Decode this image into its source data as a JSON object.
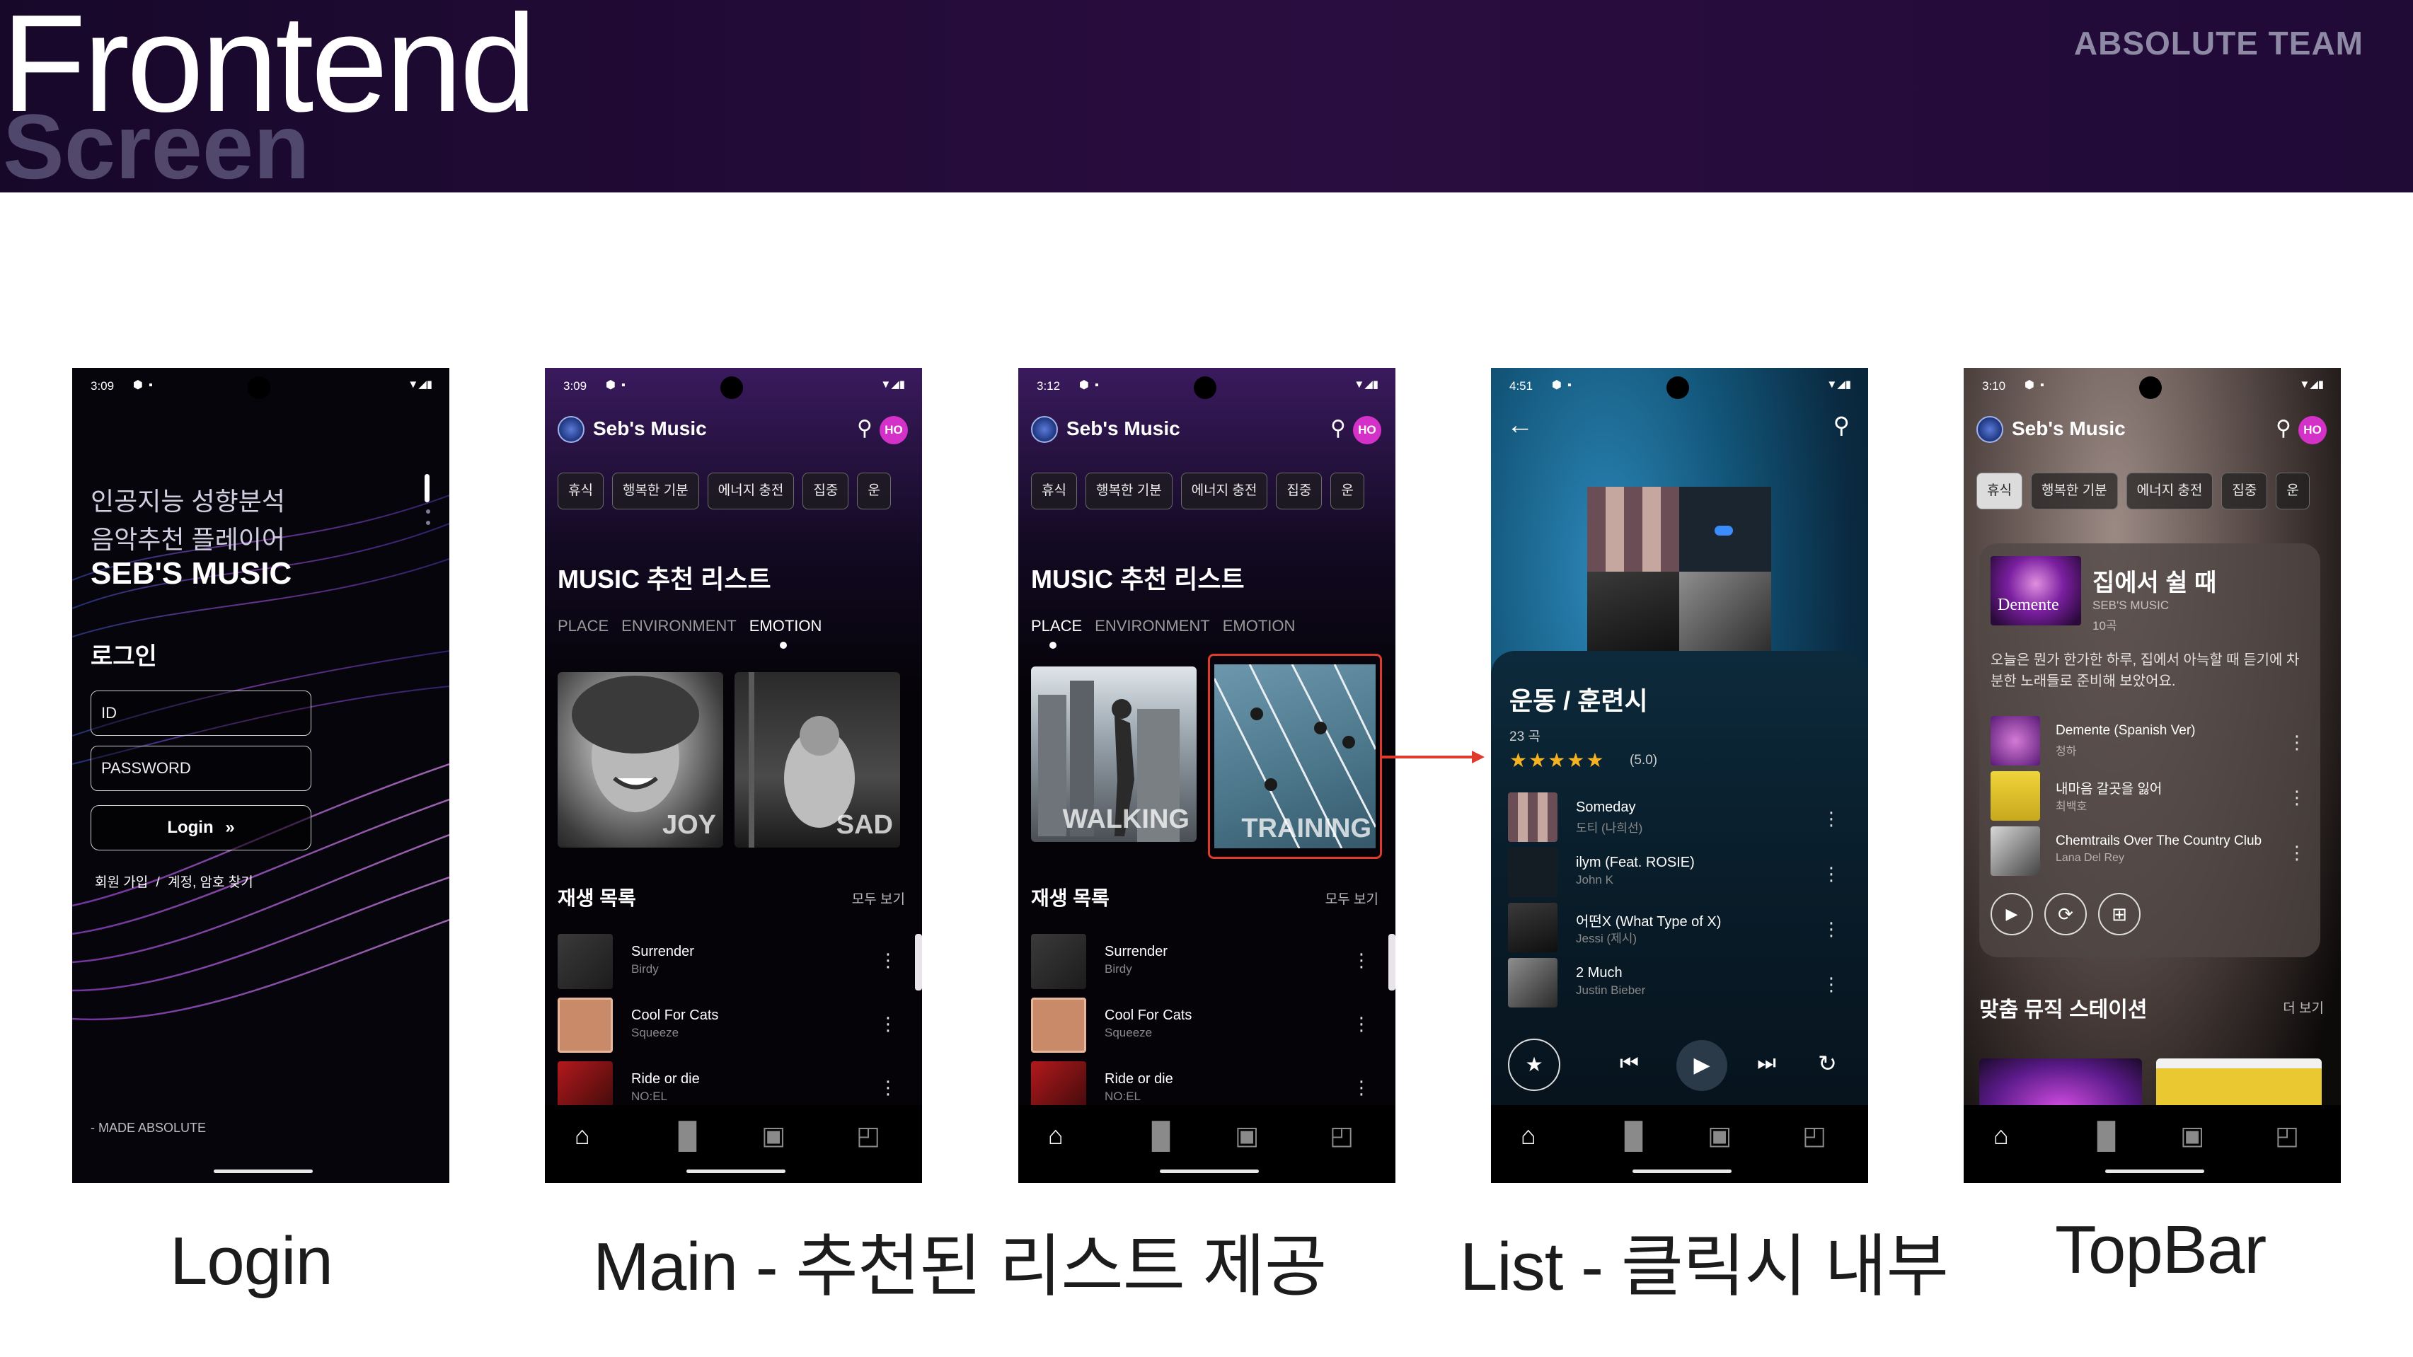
{
  "header": {
    "title": "Frontend",
    "subtitle": "Screen",
    "team": "ABSOLUTE TEAM"
  },
  "captions": {
    "login": "Login",
    "main": "Main - 추천된 리스트 제공",
    "list": "List - 클릭시 내부",
    "topbar": "TopBar"
  },
  "colors": {
    "banner": "#1f0a33",
    "accent_pink": "#d431c8",
    "highlight_red": "#e03a2c"
  },
  "login": {
    "status_time": "3:09",
    "line1": "인공지능 성향분석",
    "line2": "음악추천 플레이어",
    "brand": "SEB'S MUSIC",
    "section": "로그인",
    "id_placeholder": "ID",
    "password_placeholder": "PASSWORD",
    "login_button": "Login",
    "signup": "회원 가입",
    "separator": "/",
    "find": "계정, 암호 찾기",
    "footer": "- MADE ABSOLUTE"
  },
  "main": {
    "status_time": "3:09",
    "app_title": "Seb's Music",
    "avatar": "HO",
    "chips": [
      "휴식",
      "행복한 기분",
      "에너지 충전",
      "집중",
      "운"
    ],
    "section_title": "MUSIC 추천 리스트",
    "tabs": [
      "PLACE",
      "ENVIRONMENT",
      "EMOTION"
    ],
    "cards": [
      "JOY",
      "SAD"
    ],
    "playlist_title": "재생 목록",
    "see_all": "모두 보기",
    "songs": [
      {
        "title": "Surrender",
        "artist": "Birdy"
      },
      {
        "title": "Cool For Cats",
        "artist": "Squeeze"
      },
      {
        "title": "Ride or die",
        "artist": "NO:EL"
      }
    ]
  },
  "main2": {
    "status_time": "3:12",
    "app_title": "Seb's Music",
    "avatar": "HO",
    "chips": [
      "휴식",
      "행복한 기분",
      "에너지 충전",
      "집중",
      "운"
    ],
    "section_title": "MUSIC 추천 리스트",
    "tabs": [
      "PLACE",
      "ENVIRONMENT",
      "EMOTION"
    ],
    "cards": [
      "WALKING",
      "TRAINING"
    ],
    "playlist_title": "재생 목록",
    "see_all": "모두 보기",
    "songs": [
      {
        "title": "Surrender",
        "artist": "Birdy"
      },
      {
        "title": "Cool For Cats",
        "artist": "Squeeze"
      },
      {
        "title": "Ride or die",
        "artist": "NO:EL"
      }
    ]
  },
  "list": {
    "status_time": "4:51",
    "title": "운동 / 훈련시",
    "count": "23 곡",
    "stars": "★★★★★",
    "rating": "(5.0)",
    "songs": [
      {
        "title": "Someday",
        "artist": "도티 (나희선)"
      },
      {
        "title": "ilym (Feat. ROSIE)",
        "artist": "John K"
      },
      {
        "title": "어떤X (What Type of X)",
        "artist": "Jessi (제시)"
      },
      {
        "title": "2 Much",
        "artist": "Justin Bieber"
      }
    ]
  },
  "topbar": {
    "status_time": "3:10",
    "app_title": "Seb's Music",
    "avatar": "HO",
    "chips": [
      "휴식",
      "행복한 기분",
      "에너지 충전",
      "집중",
      "운"
    ],
    "card_title": "집에서 쉴 때",
    "card_brand": "SEB'S MUSIC",
    "card_count": "10곡",
    "album_label": "Demente",
    "card_desc": "오늘은 뭔가 한가한 하루, 집에서 아늑할 때 듣기에 차분한 노래들로 준비해 보았어요.",
    "songs": [
      {
        "title": "Demente (Spanish Ver)",
        "artist": "청하"
      },
      {
        "title": "내마음 갈곳을 잃어",
        "artist": "최백호"
      },
      {
        "title": "Chemtrails Over The Country Club",
        "artist": "Lana Del Rey"
      }
    ],
    "station_title": "맞춤 뮤직 스테이션",
    "more": "더 보기"
  },
  "icons": [
    "search-icon",
    "back-arrow-icon",
    "kebab-menu-icon",
    "home-icon",
    "chart-icon",
    "library-icon",
    "playlist-icon",
    "play-icon",
    "skip-previous-icon",
    "skip-next-icon",
    "repeat-icon",
    "star-icon"
  ]
}
